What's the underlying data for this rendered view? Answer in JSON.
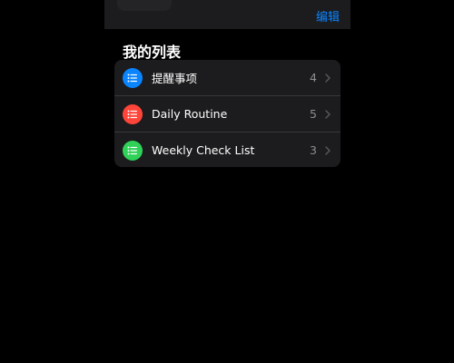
{
  "header": {
    "edit_label": "编辑"
  },
  "section": {
    "title": "我的列表"
  },
  "lists": [
    {
      "label": "提醒事项",
      "count": "4",
      "color": "#0a84ff",
      "icon": "list-bullet-icon"
    },
    {
      "label": "Daily Routine",
      "count": "5",
      "color": "#ff453a",
      "icon": "list-bullet-icon"
    },
    {
      "label": "Weekly Check List",
      "count": "3",
      "color": "#30d158",
      "icon": "list-bullet-icon"
    }
  ]
}
